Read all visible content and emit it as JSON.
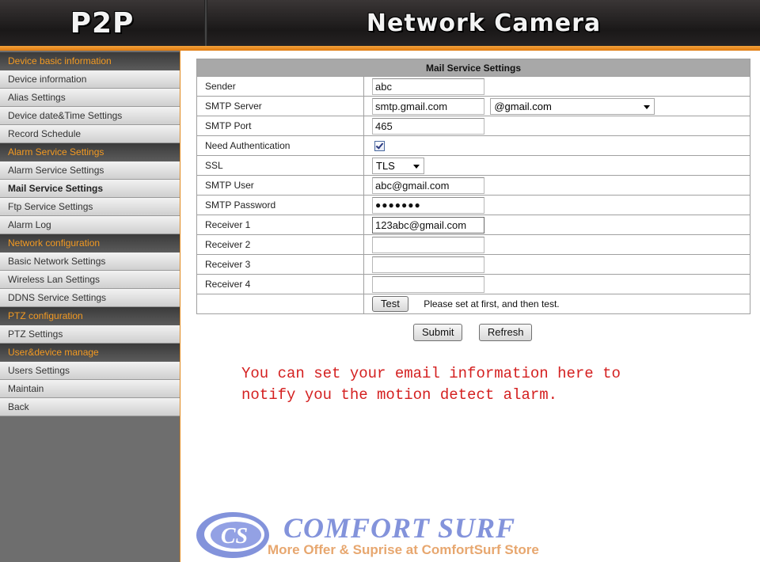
{
  "header": {
    "left_title": "P2P",
    "right_title": "Network Camera"
  },
  "sidebar": {
    "sections": [
      {
        "title": "Device basic information",
        "items": [
          "Device information",
          "Alias Settings",
          "Device date&Time Settings",
          "Record Schedule"
        ]
      },
      {
        "title": "Alarm Service Settings",
        "items": [
          "Alarm Service Settings",
          "Mail Service Settings",
          "Ftp Service Settings",
          "Alarm Log"
        ]
      },
      {
        "title": "Network configuration",
        "items": [
          "Basic Network Settings",
          "Wireless Lan Settings",
          "DDNS Service Settings"
        ]
      },
      {
        "title": "PTZ configuration",
        "items": [
          "PTZ Settings"
        ]
      },
      {
        "title": "User&device manage",
        "items": [
          "Users Settings",
          "Maintain",
          "Back"
        ]
      }
    ],
    "active_item": "Mail Service Settings"
  },
  "form": {
    "title": "Mail Service Settings",
    "sender": {
      "label": "Sender",
      "value": "abc"
    },
    "smtp_server": {
      "label": "SMTP Server",
      "value": "smtp.gmail.com",
      "preset": "@gmail.com"
    },
    "smtp_port": {
      "label": "SMTP Port",
      "value": "465"
    },
    "need_auth": {
      "label": "Need Authentication",
      "checked": true
    },
    "ssl": {
      "label": "SSL",
      "value": "TLS"
    },
    "smtp_user": {
      "label": "SMTP User",
      "value": "abc@gmail.com"
    },
    "smtp_password": {
      "label": "SMTP Password",
      "value": "●●●●●●●"
    },
    "receiver1": {
      "label": "Receiver 1",
      "value": "123abc@gmail.com"
    },
    "receiver2": {
      "label": "Receiver 2",
      "value": ""
    },
    "receiver3": {
      "label": "Receiver 3",
      "value": ""
    },
    "receiver4": {
      "label": "Receiver 4",
      "value": ""
    },
    "test_label": "Test",
    "test_hint": "Please set at first, and then test."
  },
  "actions": {
    "submit_label": "Submit",
    "refresh_label": "Refresh"
  },
  "note": {
    "line1": "You can set your email information here to",
    "line2": "notify you the motion detect alarm."
  },
  "watermark": {
    "logo_letters": "CS",
    "title": "COMFORT SURF",
    "subtitle": "More Offer & Suprise at ComfortSurf Store"
  },
  "colors": {
    "accent_orange": "#f39a22",
    "note_red": "#d42020",
    "watermark_blue": "#5a6fd0"
  }
}
